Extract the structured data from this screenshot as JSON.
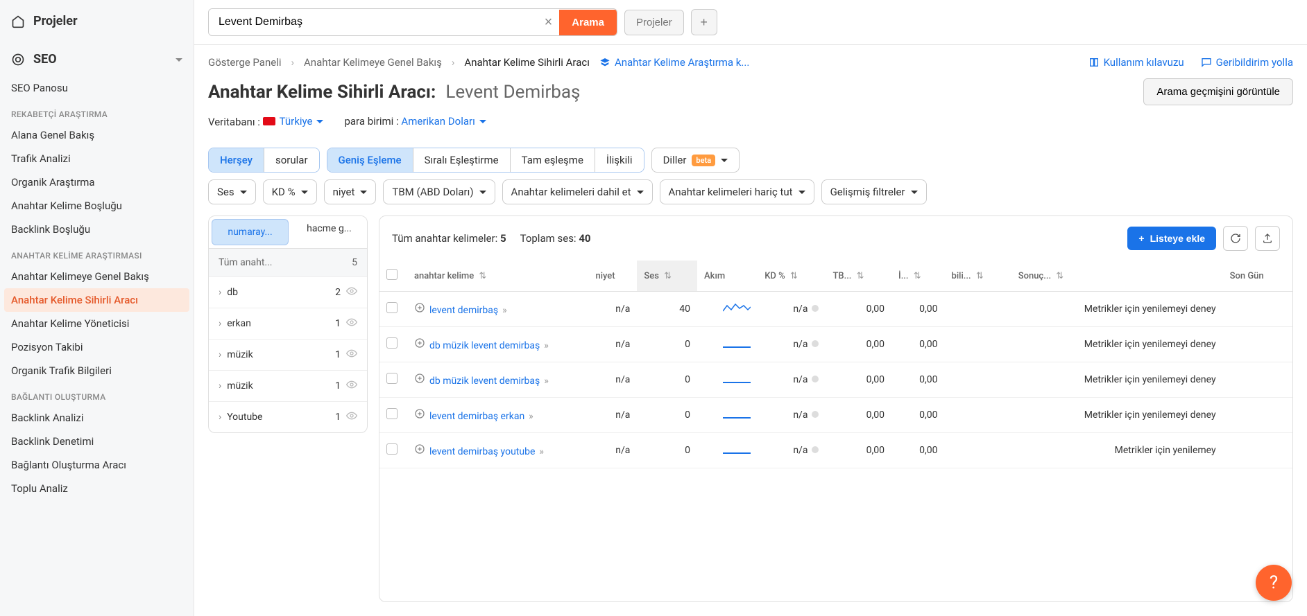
{
  "sidebar": {
    "projects_label": "Projeler",
    "seo_label": "SEO",
    "items": [
      "SEO Panosu"
    ],
    "group1_label": "REKABETÇİ ARAŞTIRMA",
    "group1_items": [
      "Alana Genel Bakış",
      "Trafik Analizi",
      "Organik Araştırma",
      "Anahtar Kelime Boşluğu",
      "Backlink Boşluğu"
    ],
    "group2_label": "ANAHTAR KELİME ARAŞTIRMASI",
    "group2_items": [
      "Anahtar Kelimeye Genel Bakış",
      "Anahtar Kelime Sihirli Aracı",
      "Anahtar Kelime Yöneticisi",
      "Pozisyon Takibi",
      "Organik Trafik Bilgileri"
    ],
    "group2_active_index": 1,
    "group3_label": "BAĞLANTI OLUŞTURMA",
    "group3_items": [
      "Backlink Analizi",
      "Backlink Denetimi",
      "Bağlantı Oluşturma Aracı",
      "Toplu Analiz"
    ]
  },
  "topbar": {
    "search_value": "Levent Demirbaş",
    "search_btn": "Arama",
    "projects_btn": "Projeler"
  },
  "breadcrumb": {
    "items": [
      "Gösterge Paneli",
      "Anahtar Kelimeye Genel Bakış",
      "Anahtar Kelime Sihirli Aracı"
    ],
    "research_link": "Anahtar Kelime Araştırma k...",
    "guide_link": "Kullanım kılavuzu",
    "feedback_link": "Geribildirim yolla"
  },
  "title": {
    "tool": "Anahtar Kelime Sihirli Aracı:",
    "term": "Levent Demirbaş",
    "history_btn": "Arama geçmişini görüntüle"
  },
  "meta": {
    "db_label": "Veritabanı :",
    "db_value": "Türkiye",
    "cur_label": "para birimi :",
    "cur_value": "Amerikan Doları"
  },
  "filters": {
    "match": [
      "Herşey",
      "sorular"
    ],
    "match2": [
      "Geniş Eşleme",
      "Sıralı Eşleştirme",
      "Tam eşleşme",
      "İlişkili"
    ],
    "diller": "Diller",
    "beta": "beta",
    "row2": [
      "Ses",
      "KD %",
      "niyet",
      "TBM (ABD Doları)",
      "Anahtar kelimeleri dahil et",
      "Anahtar kelimeleri hariç tut",
      "Gelişmiş filtreler"
    ]
  },
  "left_panel": {
    "tab1": "numaray...",
    "tab2": "hacme g...",
    "header_label": "Tüm anaht...",
    "header_count": "5",
    "items": [
      {
        "label": "db",
        "count": "2"
      },
      {
        "label": "erkan",
        "count": "1"
      },
      {
        "label": "müzik",
        "count": "1"
      },
      {
        "label": "müzik",
        "count": "1"
      },
      {
        "label": "Youtube",
        "count": "1"
      }
    ]
  },
  "table": {
    "all_kw_label": "Tüm anahtar kelimeler:",
    "all_kw_count": "5",
    "total_vol_label": "Toplam ses:",
    "total_vol_count": "40",
    "add_list_btn": "Listeye ekle",
    "columns": [
      "anahtar kelime",
      "niyet",
      "Ses",
      "Akım",
      "KD %",
      "TB...",
      "İ...",
      "bili...",
      "Sonuç...",
      "Son Gün"
    ],
    "rows": [
      {
        "keyword": "levent demirbaş",
        "niyet": "n/a",
        "ses": "40",
        "trend": "wave",
        "kd": "n/a",
        "tbm": "0,00",
        "i": "0,00",
        "bili": "",
        "sonuc": "Metrikler için yenilemeyi deney"
      },
      {
        "keyword": "db müzik levent demirbaş",
        "niyet": "n/a",
        "ses": "0",
        "trend": "flat",
        "kd": "n/a",
        "tbm": "0,00",
        "i": "0,00",
        "bili": "",
        "sonuc": "Metrikler için yenilemeyi deney"
      },
      {
        "keyword": "db müzik levent demirbaş",
        "niyet": "n/a",
        "ses": "0",
        "trend": "flat",
        "kd": "n/a",
        "tbm": "0,00",
        "i": "0,00",
        "bili": "",
        "sonuc": "Metrikler için yenilemeyi deney"
      },
      {
        "keyword": "levent demirbaş erkan",
        "niyet": "n/a",
        "ses": "0",
        "trend": "flat",
        "kd": "n/a",
        "tbm": "0,00",
        "i": "0,00",
        "bili": "",
        "sonuc": "Metrikler için yenilemeyi deney"
      },
      {
        "keyword": "levent demirbaş youtube",
        "niyet": "n/a",
        "ses": "0",
        "trend": "flat",
        "kd": "n/a",
        "tbm": "0,00",
        "i": "0,00",
        "bili": "",
        "sonuc": "Metrikler için yenilemey"
      }
    ]
  }
}
